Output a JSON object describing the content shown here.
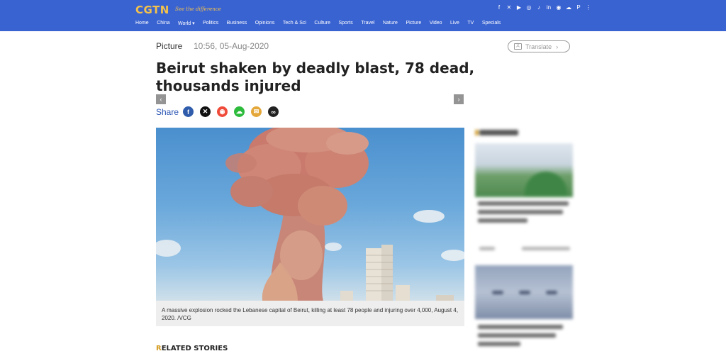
{
  "header": {
    "logo": "CGTN",
    "slogan": "See the difference",
    "social_icons": [
      "facebook-icon",
      "x-icon",
      "youtube-icon",
      "instagram-icon",
      "tiktok-icon",
      "linkedin-icon",
      "weibo-icon",
      "wechat-icon",
      "pinterest-icon",
      "more-icon"
    ],
    "nav": [
      "Home",
      "China",
      "World ▾",
      "Politics",
      "Business",
      "Opinions",
      "Tech & Sci",
      "Culture",
      "Sports",
      "Travel",
      "Nature",
      "Picture",
      "Video",
      "Live",
      "TV",
      "Specials"
    ]
  },
  "article": {
    "category": "Picture",
    "datetime": "10:56, 05-Aug-2020",
    "translate_label": "Translate",
    "headline": "Beirut shaken by deadly blast, 78 dead, thousands injured",
    "share_label": "Share",
    "share_icons": [
      "facebook-icon",
      "x-icon",
      "weibo-icon",
      "wechat-icon",
      "email-icon",
      "link-icon"
    ],
    "caption": "A massive explosion rocked the Lebanese capital of Beirut, killing at least 78 people and injuring over 4,000, August 4, 2020. /VCG",
    "prev_arrow": "‹",
    "next_arrow": "›"
  },
  "related": {
    "first_letter": "R",
    "rest": "ELATED STORIES"
  },
  "colors": {
    "header_bg": "#3a63d2",
    "logo": "#f4c24a",
    "share_label": "#2a55b3",
    "related_accent": "#d49b1f"
  }
}
